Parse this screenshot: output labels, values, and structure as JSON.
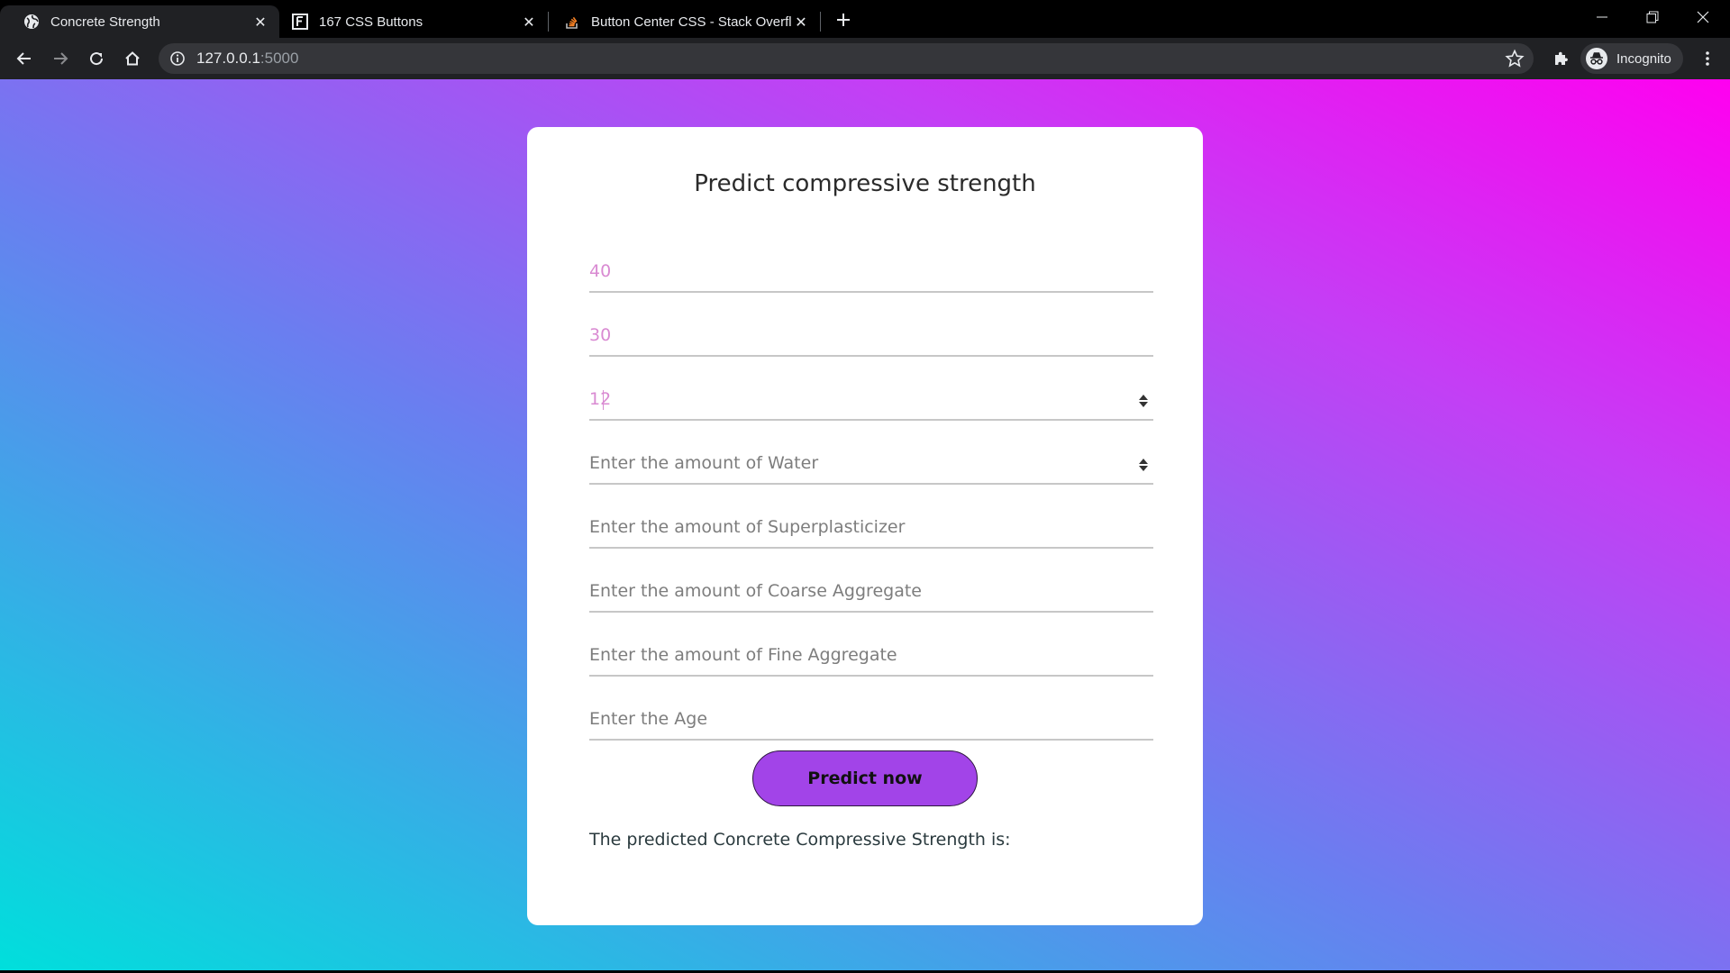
{
  "browser": {
    "tabs": [
      {
        "title": "Concrete Strength",
        "favicon": "globe-icon",
        "active": true
      },
      {
        "title": "167 CSS Buttons",
        "favicon": "site-logo-icon",
        "active": false
      },
      {
        "title": "Button Center CSS - Stack Overfl",
        "favicon": "stackoverflow-icon",
        "active": false
      }
    ],
    "url_host": "127.0.0.1",
    "url_port": ":5000",
    "profile_label": "Incognito"
  },
  "page": {
    "title": "Predict compressive strength",
    "fields": [
      {
        "value": "40",
        "placeholder": "",
        "spinner": false
      },
      {
        "value": "30",
        "placeholder": "",
        "spinner": false
      },
      {
        "value": "12",
        "placeholder": "",
        "spinner": true
      },
      {
        "value": "",
        "placeholder": "Enter the amount of Water",
        "spinner": true
      },
      {
        "value": "",
        "placeholder": "Enter the amount of Superplasticizer",
        "spinner": false
      },
      {
        "value": "",
        "placeholder": "Enter the amount of Coarse Aggregate",
        "spinner": false
      },
      {
        "value": "",
        "placeholder": "Enter the amount of Fine Aggregate",
        "spinner": false
      },
      {
        "value": "",
        "placeholder": "Enter the Age",
        "spinner": false
      }
    ],
    "button_label": "Predict now",
    "result_text": "The predicted Concrete Compressive Strength is:"
  },
  "colors": {
    "button": "#a244e8",
    "input_value": "#d98ad2",
    "gradient": [
      "#00dfdc",
      "#6a7ef0",
      "#c43ef5",
      "#ff00f0"
    ]
  }
}
